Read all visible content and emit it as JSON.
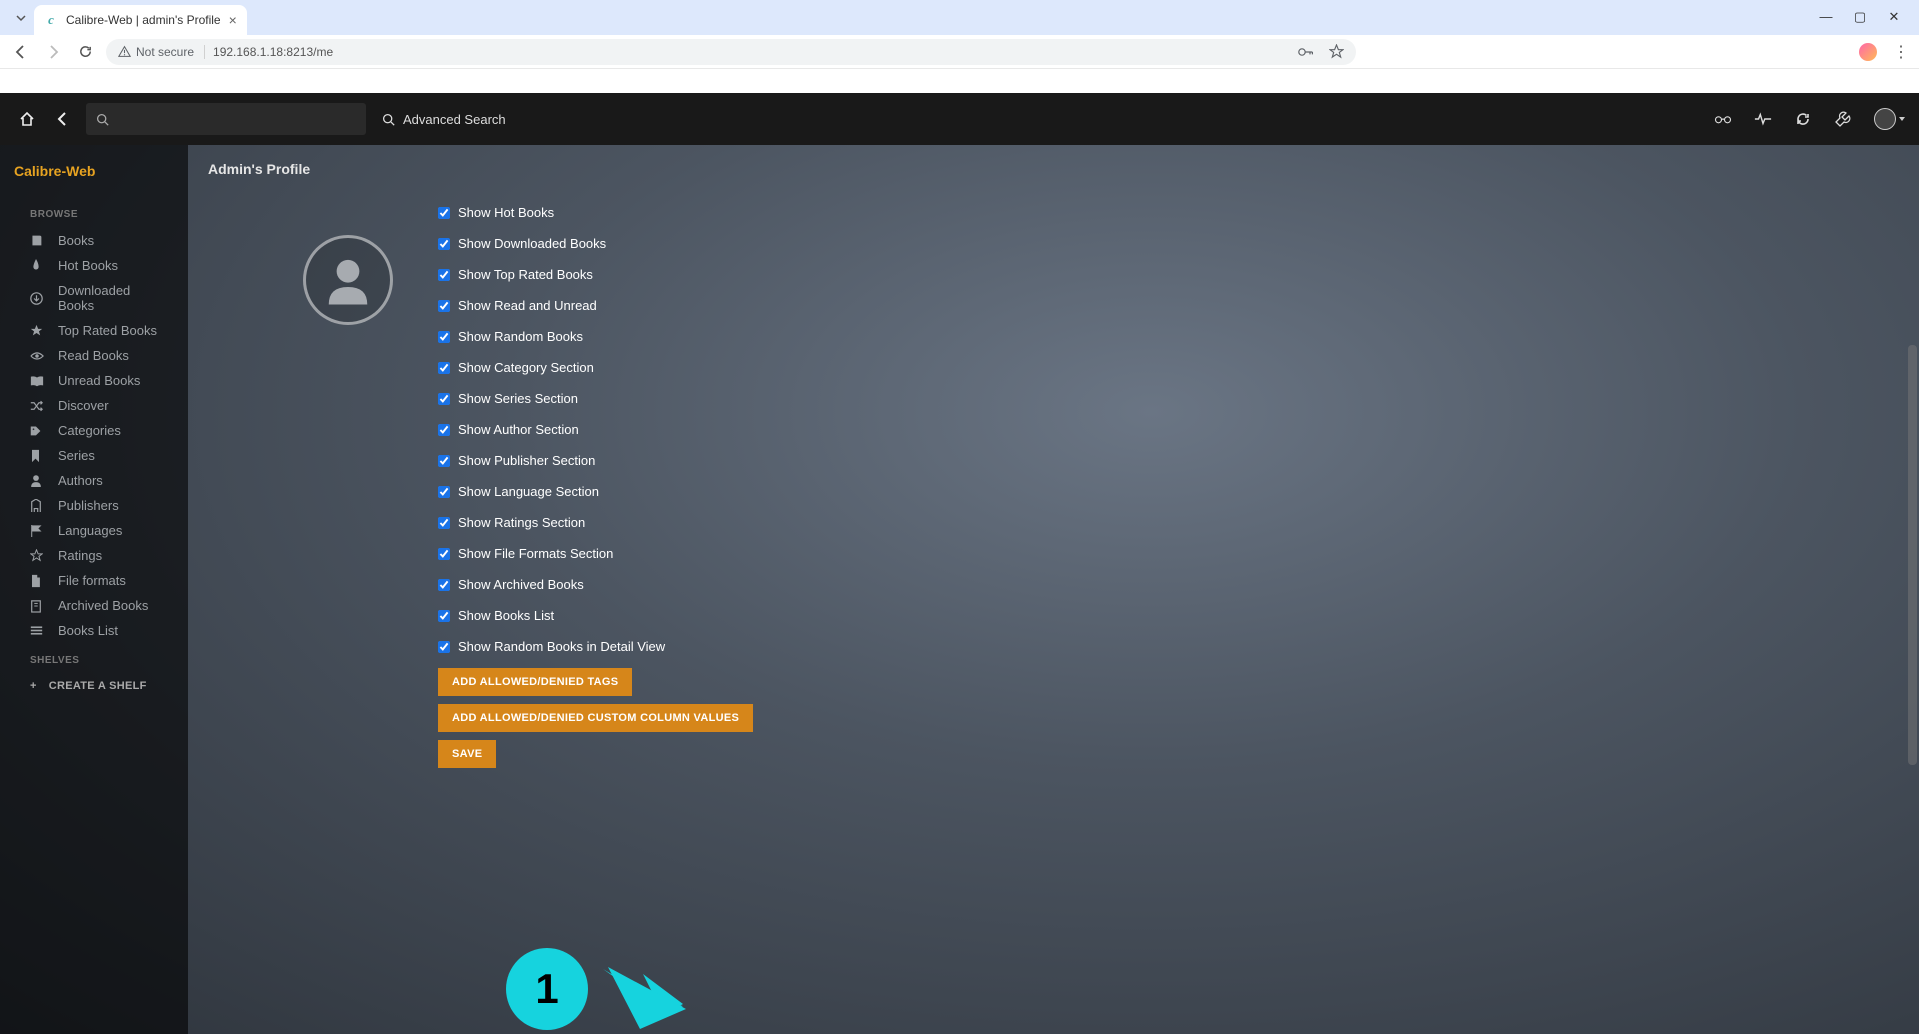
{
  "browser": {
    "tab_title": "Calibre-Web | admin's Profile",
    "not_secure_label": "Not secure",
    "url": "192.168.1.18:8213/me"
  },
  "header": {
    "search_placeholder": "",
    "advanced_search_label": "Advanced Search"
  },
  "sidebar": {
    "brand": "Calibre-Web",
    "browse_label": "BROWSE",
    "items": [
      {
        "icon": "book",
        "label": "Books"
      },
      {
        "icon": "flame",
        "label": "Hot Books"
      },
      {
        "icon": "download",
        "label": "Downloaded Books"
      },
      {
        "icon": "star",
        "label": "Top Rated Books"
      },
      {
        "icon": "eye",
        "label": "Read Books"
      },
      {
        "icon": "book-open",
        "label": "Unread Books"
      },
      {
        "icon": "shuffle",
        "label": "Discover"
      },
      {
        "icon": "tags",
        "label": "Categories"
      },
      {
        "icon": "bookmark",
        "label": "Series"
      },
      {
        "icon": "user",
        "label": "Authors"
      },
      {
        "icon": "building",
        "label": "Publishers"
      },
      {
        "icon": "flag",
        "label": "Languages"
      },
      {
        "icon": "star-o",
        "label": "Ratings"
      },
      {
        "icon": "file",
        "label": "File formats"
      },
      {
        "icon": "archive",
        "label": "Archived Books"
      },
      {
        "icon": "list",
        "label": "Books List"
      }
    ],
    "shelves_label": "SHELVES",
    "create_shelf_label": "CREATE A SHELF"
  },
  "main": {
    "page_title": "Admin's Profile",
    "checkboxes": [
      {
        "label": "Show Hot Books",
        "checked": true
      },
      {
        "label": "Show Downloaded Books",
        "checked": true
      },
      {
        "label": "Show Top Rated Books",
        "checked": true
      },
      {
        "label": "Show Read and Unread",
        "checked": true
      },
      {
        "label": "Show Random Books",
        "checked": true
      },
      {
        "label": "Show Category Section",
        "checked": true
      },
      {
        "label": "Show Series Section",
        "checked": true
      },
      {
        "label": "Show Author Section",
        "checked": true
      },
      {
        "label": "Show Publisher Section",
        "checked": true
      },
      {
        "label": "Show Language Section",
        "checked": true
      },
      {
        "label": "Show Ratings Section",
        "checked": true
      },
      {
        "label": "Show File Formats Section",
        "checked": true
      },
      {
        "label": "Show Archived Books",
        "checked": true
      },
      {
        "label": "Show Books List",
        "checked": true
      },
      {
        "label": "Show Random Books in Detail View",
        "checked": true
      }
    ],
    "buttons": {
      "add_tags": "ADD ALLOWED/DENIED TAGS",
      "add_cols": "ADD ALLOWED/DENIED CUSTOM COLUMN VALUES",
      "save": "SAVE"
    }
  },
  "annotation": {
    "number": "1"
  }
}
